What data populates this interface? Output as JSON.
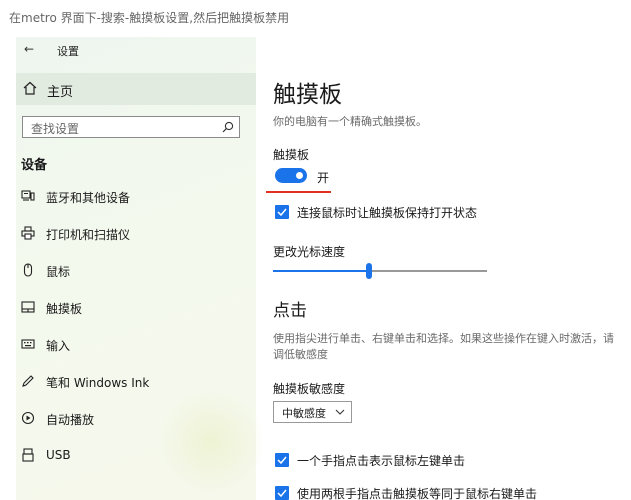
{
  "instruction": "在metro 界面下-搜索-触摸板设置,然后把触摸板禁用",
  "titlebar": {
    "back_glyph": "←",
    "title": "设置"
  },
  "sidebar": {
    "home_label": "主页",
    "search_placeholder": "查找设置",
    "section_label": "设备",
    "items": [
      {
        "label": "蓝牙和其他设备",
        "icon": "bluetooth-devices-icon"
      },
      {
        "label": "打印机和扫描仪",
        "icon": "printer-icon"
      },
      {
        "label": "鼠标",
        "icon": "mouse-icon"
      },
      {
        "label": "触摸板",
        "icon": "touchpad-icon"
      },
      {
        "label": "输入",
        "icon": "keyboard-icon"
      },
      {
        "label": "笔和 Windows Ink",
        "icon": "pen-icon"
      },
      {
        "label": "自动播放",
        "icon": "autoplay-icon"
      },
      {
        "label": "USB",
        "icon": "usb-icon"
      }
    ]
  },
  "main": {
    "title": "触摸板",
    "subtitle": "你的电脑有一个精确式触摸板。",
    "touchpad_label": "触摸板",
    "toggle_state": "开",
    "toggle_on": true,
    "keep_on_label": "连接鼠标时让触摸板保持打开状态",
    "keep_on_checked": true,
    "cursor_speed_label": "更改光标速度",
    "cursor_speed_level": 0.45,
    "taps_heading": "点击",
    "taps_description": "使用指尖进行单击、右键单击和选择。如果这些操作在键入时激活，请调低敏感度",
    "sensitivity_label": "触摸板敏感度",
    "sensitivity_value": "中敏感度",
    "tap_single_label": "一个手指点击表示鼠标左键单击",
    "tap_single_checked": true,
    "tap_double_label": "使用两根手指点击触摸板等同于鼠标右键单击",
    "tap_double_checked": true
  },
  "colors": {
    "accent": "#1a73e8",
    "annotation_underline": "#e0301e",
    "home_highlight": "#e2ebe0"
  }
}
